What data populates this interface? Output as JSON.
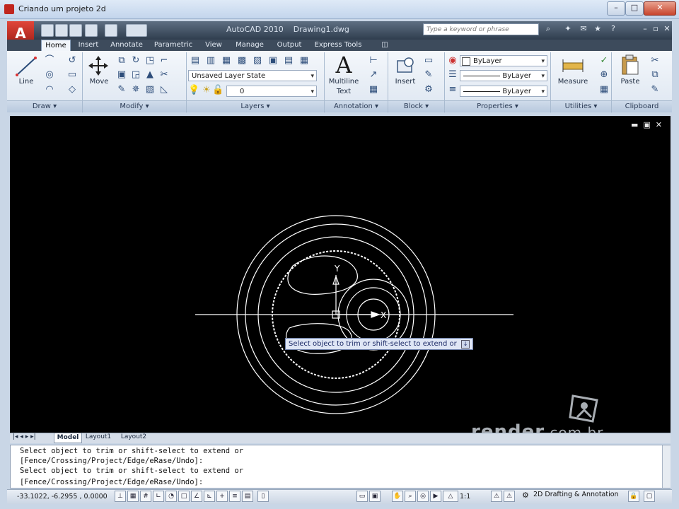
{
  "window": {
    "title": "Criando um projeto 2d"
  },
  "app": {
    "title": "AutoCAD 2010",
    "file": "Drawing1.dwg",
    "logo": "A",
    "search_placeholder": "Type a keyword or phrase"
  },
  "tabs": [
    "Home",
    "Insert",
    "Annotate",
    "Parametric",
    "View",
    "Manage",
    "Output",
    "Express Tools"
  ],
  "ribbon": {
    "draw": {
      "label": "Draw",
      "line": "Line"
    },
    "modify": {
      "label": "Modify",
      "move": "Move"
    },
    "layers": {
      "label": "Layers",
      "layer_state": "Unsaved Layer State",
      "current_layer": "0"
    },
    "annotation": {
      "label": "Annotation",
      "multiline_text_line1": "Multiline",
      "multiline_text_line2": "Text",
      "big_glyph": "A"
    },
    "block": {
      "label": "Block",
      "insert": "Insert"
    },
    "properties": {
      "label": "Properties",
      "color": "ByLayer",
      "linetype": "ByLayer",
      "lineweight": "ByLayer"
    },
    "utilities": {
      "label": "Utilities",
      "measure": "Measure"
    },
    "clipboard": {
      "label": "Clipboard",
      "paste": "Paste"
    }
  },
  "canvas": {
    "tooltip": "Select object to trim or shift-select to extend or",
    "axis_y": "Y",
    "axis_x": "X"
  },
  "layout_tabs": [
    "Model",
    "Layout1",
    "Layout2"
  ],
  "command_lines": [
    "Select object to trim or shift-select to extend or",
    "[Fence/Crossing/Project/Edge/eRase/Undo]:",
    "Select object to trim or shift-select to extend or",
    "[Fence/Crossing/Project/Edge/eRase/Undo]:"
  ],
  "status": {
    "coordinates": "-33.1022, -6.2955 , 0.0000",
    "scale": "1:1",
    "workspace": "2D Drafting & Annotation"
  },
  "watermark": {
    "main": "render",
    "suffix": ".com.br"
  },
  "colors": {
    "canvas": "#000000",
    "geometry": "#ffffff",
    "tooltip_bg": "#dfe6f5",
    "ribbon_bg": "#e6edf6"
  }
}
